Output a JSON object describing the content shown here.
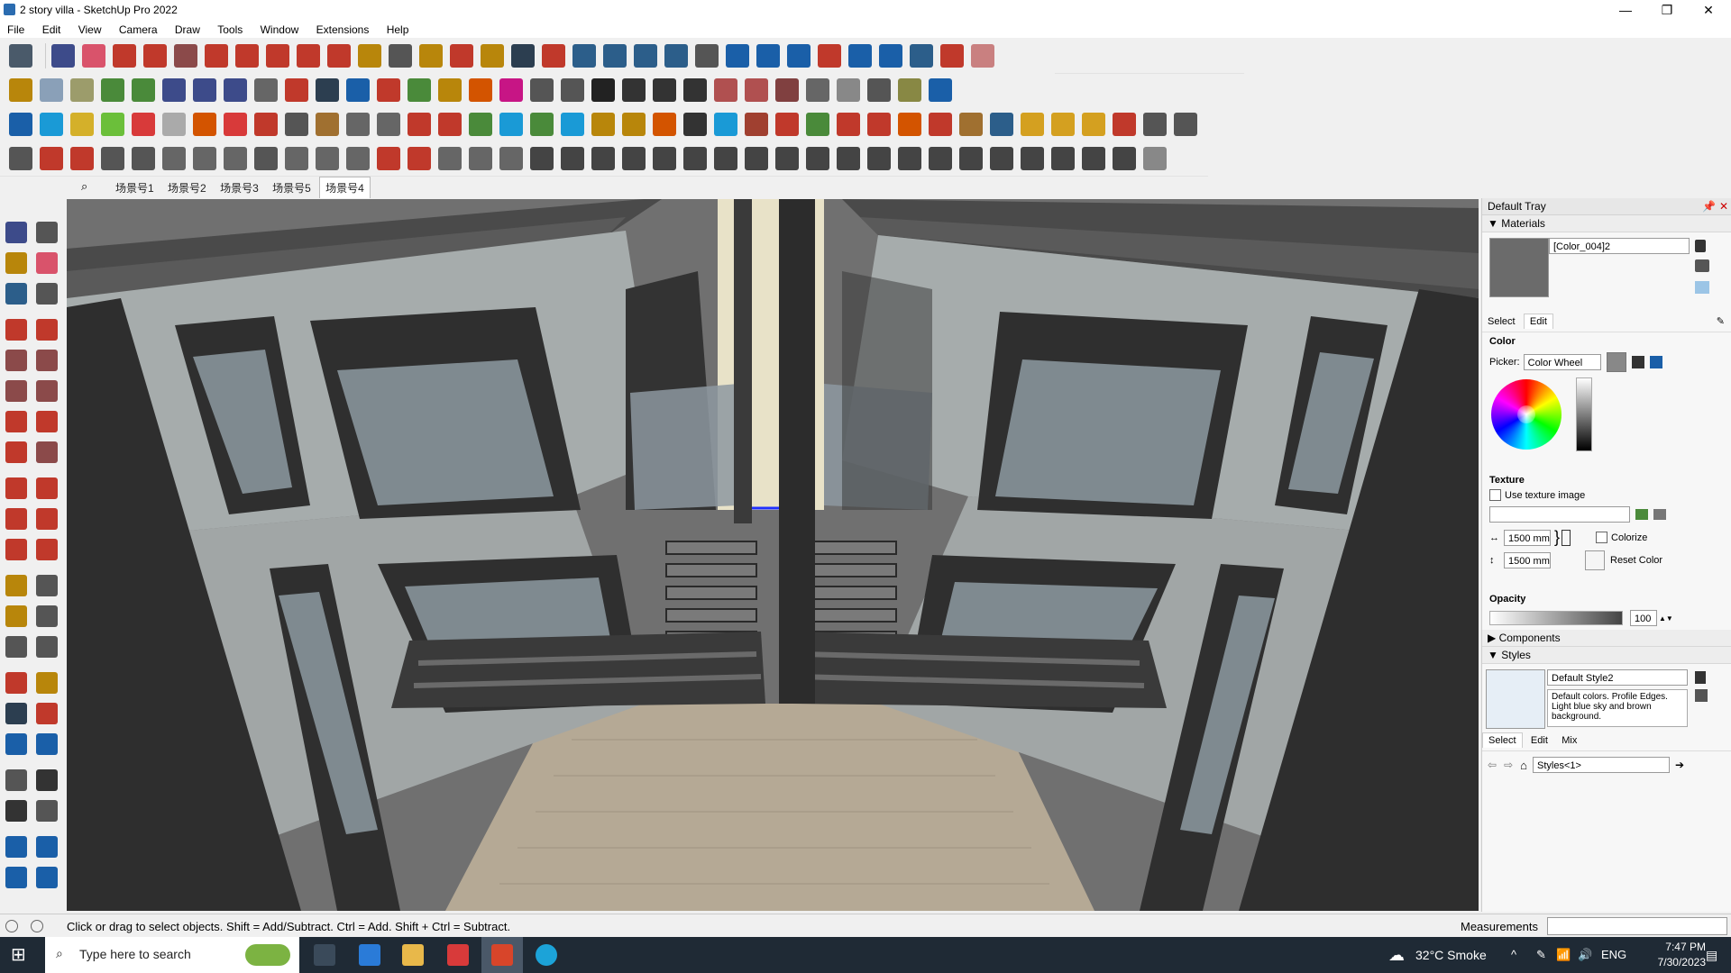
{
  "window": {
    "title": "2 story villa - SketchUp Pro 2022",
    "controls": {
      "minimize": "—",
      "maximize": "❐",
      "close": "✕"
    }
  },
  "menu": [
    "File",
    "Edit",
    "View",
    "Camera",
    "Draw",
    "Tools",
    "Window",
    "Extensions",
    "Help"
  ],
  "scenes": {
    "search_icon": "search-icon",
    "tabs": [
      "场景号1",
      "场景号2",
      "场景号3",
      "场景号5",
      "场景号4"
    ],
    "active": "场景号4"
  },
  "tray": {
    "title": "Default Tray",
    "materials": {
      "header": "Materials",
      "name": "[Color_004]2",
      "tabs": [
        "Select",
        "Edit"
      ],
      "active_tab": "Edit",
      "color_label": "Color",
      "picker_label": "Picker:",
      "picker_value": "Color Wheel",
      "texture_label": "Texture",
      "use_texture_label": "Use texture image",
      "texture_path": "",
      "width": "1500 mm",
      "height": "1500 mm",
      "colorize_label": "Colorize",
      "reset_color_label": "Reset Color",
      "opacity_label": "Opacity",
      "opacity_value": "100",
      "swatch_color": "#6b6b6b"
    },
    "components": {
      "header": "Components"
    },
    "styles": {
      "header": "Styles",
      "name": "Default Style2",
      "description": "Default colors. Profile Edges. Light blue sky and brown background.",
      "tabs": [
        "Select",
        "Edit",
        "Mix"
      ],
      "active_tab": "Select",
      "collection": "Styles<1>"
    }
  },
  "status": {
    "hint": "Click or drag to select objects. Shift = Add/Subtract. Ctrl = Add. Shift + Ctrl = Subtract.",
    "measurements_label": "Measurements",
    "measurements_value": ""
  },
  "taskbar": {
    "search_placeholder": "Type here to search",
    "weather": "32°C  Smoke",
    "language": "ENG",
    "time": "7:47 PM",
    "date": "7/30/2023"
  },
  "colors": {
    "accent": "#2b6cb0",
    "taskbar": "#1f2a35",
    "viewport_bg": "#6b6b6b"
  }
}
